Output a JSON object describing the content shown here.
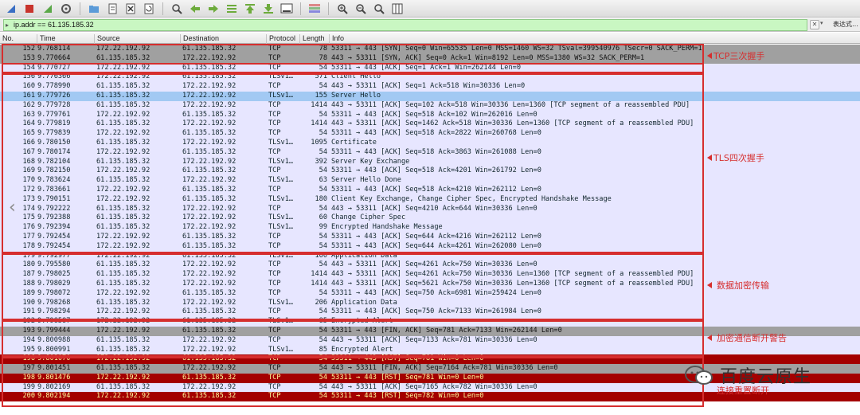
{
  "toolbar": {
    "buttons": [
      "shark-fin-icon",
      "stop-icon",
      "restart-icon",
      "options-icon",
      "open-folder-icon",
      "file-icon",
      "close-file-icon",
      "reload-icon",
      "find-icon",
      "back-icon",
      "forward-icon",
      "goto-icon",
      "first-icon",
      "last-icon",
      "autoscroll-icon",
      "colorize-icon",
      "zoom-in-icon",
      "zoom-out-icon",
      "zoom-normal-icon",
      "resize-columns-icon"
    ]
  },
  "filter": {
    "value": "ip.addr == 61.135.185.32",
    "expression_label": "表达式…"
  },
  "columns": {
    "no": "No.",
    "time": "Time",
    "source": "Source",
    "destination": "Destination",
    "protocol": "Protocol",
    "length": "Length",
    "info": "Info"
  },
  "packets": [
    {
      "no": "152",
      "time": "9.768114",
      "src": "172.22.192.92",
      "dst": "61.135.185.32",
      "proto": "TCP",
      "len": "78",
      "info": "53311 → 443 [SYN] Seq=0 Win=65535 Len=0 MSS=1460 WS=32 TSval=399540976 TSecr=0 SACK_PERM=1",
      "style": "gray"
    },
    {
      "no": "153",
      "time": "9.770664",
      "src": "61.135.185.32",
      "dst": "172.22.192.92",
      "proto": "TCP",
      "len": "78",
      "info": "443 → 53311 [SYN, ACK] Seq=0 Ack=1 Win=8192 Len=0 MSS=1380 WS=32 SACK_PERM=1",
      "style": "gray"
    },
    {
      "no": "154",
      "time": "9.770727",
      "src": "172.22.192.92",
      "dst": "61.135.185.32",
      "proto": "TCP",
      "len": "54",
      "info": "53311 → 443 [ACK] Seq=1 Ack=1 Win=262144 Len=0",
      "style": "tcp"
    },
    {
      "no": "156",
      "time": "9.776366",
      "src": "172.22.192.92",
      "dst": "61.135.185.32",
      "proto": "TLSv1…",
      "len": "571",
      "info": "Client Hello",
      "style": "tls"
    },
    {
      "no": "160",
      "time": "9.778990",
      "src": "61.135.185.32",
      "dst": "172.22.192.92",
      "proto": "TCP",
      "len": "54",
      "info": "443 → 53311 [ACK] Seq=1 Ack=518 Win=30336 Len=0",
      "style": "tcp"
    },
    {
      "no": "161",
      "time": "9.779726",
      "src": "61.135.185.32",
      "dst": "172.22.192.92",
      "proto": "TLSv1…",
      "len": "155",
      "info": "Server Hello",
      "style": "sel"
    },
    {
      "no": "162",
      "time": "9.779728",
      "src": "61.135.185.32",
      "dst": "172.22.192.92",
      "proto": "TCP",
      "len": "1414",
      "info": "443 → 53311 [ACK] Seq=102 Ack=518 Win=30336 Len=1360 [TCP segment of a reassembled PDU]",
      "style": "tcp"
    },
    {
      "no": "163",
      "time": "9.779761",
      "src": "172.22.192.92",
      "dst": "61.135.185.32",
      "proto": "TCP",
      "len": "54",
      "info": "53311 → 443 [ACK] Seq=518 Ack=102 Win=262016 Len=0",
      "style": "tcp"
    },
    {
      "no": "164",
      "time": "9.779819",
      "src": "61.135.185.32",
      "dst": "172.22.192.92",
      "proto": "TCP",
      "len": "1414",
      "info": "443 → 53311 [ACK] Seq=1462 Ack=518 Win=30336 Len=1360 [TCP segment of a reassembled PDU]",
      "style": "tcp"
    },
    {
      "no": "165",
      "time": "9.779839",
      "src": "172.22.192.92",
      "dst": "61.135.185.32",
      "proto": "TCP",
      "len": "54",
      "info": "53311 → 443 [ACK] Seq=518 Ack=2822 Win=260768 Len=0",
      "style": "tcp"
    },
    {
      "no": "166",
      "time": "9.780150",
      "src": "61.135.185.32",
      "dst": "172.22.192.92",
      "proto": "TLSv1…",
      "len": "1095",
      "info": "Certificate",
      "style": "tls"
    },
    {
      "no": "167",
      "time": "9.780174",
      "src": "172.22.192.92",
      "dst": "61.135.185.32",
      "proto": "TCP",
      "len": "54",
      "info": "53311 → 443 [ACK] Seq=518 Ack=3863 Win=261088 Len=0",
      "style": "tcp"
    },
    {
      "no": "168",
      "time": "9.782104",
      "src": "61.135.185.32",
      "dst": "172.22.192.92",
      "proto": "TLSv1…",
      "len": "392",
      "info": "Server Key Exchange",
      "style": "tls"
    },
    {
      "no": "169",
      "time": "9.782150",
      "src": "172.22.192.92",
      "dst": "61.135.185.32",
      "proto": "TCP",
      "len": "54",
      "info": "53311 → 443 [ACK] Seq=518 Ack=4201 Win=261792 Len=0",
      "style": "tcp"
    },
    {
      "no": "170",
      "time": "9.783624",
      "src": "61.135.185.32",
      "dst": "172.22.192.92",
      "proto": "TLSv1…",
      "len": "63",
      "info": "Server Hello Done",
      "style": "tls"
    },
    {
      "no": "172",
      "time": "9.783661",
      "src": "172.22.192.92",
      "dst": "61.135.185.32",
      "proto": "TCP",
      "len": "54",
      "info": "53311 → 443 [ACK] Seq=518 Ack=4210 Win=262112 Len=0",
      "style": "tcp"
    },
    {
      "no": "173",
      "time": "9.790151",
      "src": "172.22.192.92",
      "dst": "61.135.185.32",
      "proto": "TLSv1…",
      "len": "180",
      "info": "Client Key Exchange, Change Cipher Spec, Encrypted Handshake Message",
      "style": "tls"
    },
    {
      "no": "174",
      "time": "9.792222",
      "src": "61.135.185.32",
      "dst": "172.22.192.92",
      "proto": "TCP",
      "len": "54",
      "info": "443 → 53311 [ACK] Seq=4210 Ack=644 Win=30336 Len=0",
      "style": "tcp"
    },
    {
      "no": "175",
      "time": "9.792388",
      "src": "61.135.185.32",
      "dst": "172.22.192.92",
      "proto": "TLSv1…",
      "len": "60",
      "info": "Change Cipher Spec",
      "style": "tls"
    },
    {
      "no": "176",
      "time": "9.792394",
      "src": "61.135.185.32",
      "dst": "172.22.192.92",
      "proto": "TLSv1…",
      "len": "99",
      "info": "Encrypted Handshake Message",
      "style": "tls"
    },
    {
      "no": "177",
      "time": "9.792454",
      "src": "172.22.192.92",
      "dst": "61.135.185.32",
      "proto": "TCP",
      "len": "54",
      "info": "53311 → 443 [ACK] Seq=644 Ack=4216 Win=262112 Len=0",
      "style": "tcp"
    },
    {
      "no": "178",
      "time": "9.792454",
      "src": "172.22.192.92",
      "dst": "61.135.185.32",
      "proto": "TCP",
      "len": "54",
      "info": "53311 → 443 [ACK] Seq=644 Ack=4261 Win=262080 Len=0",
      "style": "tcp"
    },
    {
      "no": "179",
      "time": "9.792977",
      "src": "172.22.192.92",
      "dst": "61.135.185.32",
      "proto": "TLSv1…",
      "len": "160",
      "info": "Application Data",
      "style": "tls"
    },
    {
      "no": "180",
      "time": "9.795580",
      "src": "61.135.185.32",
      "dst": "172.22.192.92",
      "proto": "TCP",
      "len": "54",
      "info": "443 → 53311 [ACK] Seq=4261 Ack=750 Win=30336 Len=0",
      "style": "tcp"
    },
    {
      "no": "187",
      "time": "9.798025",
      "src": "61.135.185.32",
      "dst": "172.22.192.92",
      "proto": "TCP",
      "len": "1414",
      "info": "443 → 53311 [ACK] Seq=4261 Ack=750 Win=30336 Len=1360 [TCP segment of a reassembled PDU]",
      "style": "tcp"
    },
    {
      "no": "188",
      "time": "9.798029",
      "src": "61.135.185.32",
      "dst": "172.22.192.92",
      "proto": "TCP",
      "len": "1414",
      "info": "443 → 53311 [ACK] Seq=5621 Ack=750 Win=30336 Len=1360 [TCP segment of a reassembled PDU]",
      "style": "tcp"
    },
    {
      "no": "189",
      "time": "9.798072",
      "src": "172.22.192.92",
      "dst": "61.135.185.32",
      "proto": "TCP",
      "len": "54",
      "info": "53311 → 443 [ACK] Seq=750 Ack=6981 Win=259424 Len=0",
      "style": "tcp"
    },
    {
      "no": "190",
      "time": "9.798268",
      "src": "61.135.185.32",
      "dst": "172.22.192.92",
      "proto": "TLSv1…",
      "len": "206",
      "info": "Application Data",
      "style": "tls"
    },
    {
      "no": "191",
      "time": "9.798294",
      "src": "172.22.192.92",
      "dst": "61.135.185.32",
      "proto": "TCP",
      "len": "54",
      "info": "53311 → 443 [ACK] Seq=750 Ack=7133 Win=261984 Len=0",
      "style": "tcp"
    },
    {
      "no": "192",
      "time": "9.798587",
      "src": "172.22.192.92",
      "dst": "61.135.185.32",
      "proto": "TLSv1…",
      "len": "85",
      "info": "Encrypted Alert",
      "style": "tls"
    },
    {
      "no": "193",
      "time": "9.799444",
      "src": "172.22.192.92",
      "dst": "61.135.185.32",
      "proto": "TCP",
      "len": "54",
      "info": "53311 → 443 [FIN, ACK] Seq=781 Ack=7133 Win=262144 Len=0",
      "style": "gray"
    },
    {
      "no": "194",
      "time": "9.800988",
      "src": "61.135.185.32",
      "dst": "172.22.192.92",
      "proto": "TCP",
      "len": "54",
      "info": "443 → 53311 [ACK] Seq=7133 Ack=781 Win=30336 Len=0",
      "style": "tcp"
    },
    {
      "no": "195",
      "time": "9.800991",
      "src": "61.135.185.32",
      "dst": "172.22.192.92",
      "proto": "TLSv1…",
      "len": "85",
      "info": "Encrypted Alert",
      "style": "tls"
    },
    {
      "no": "196",
      "time": "9.801070",
      "src": "172.22.192.92",
      "dst": "61.135.185.32",
      "proto": "TCP",
      "len": "54",
      "info": "53311 → 443 [RST] Seq=781 Win=0 Len=0",
      "style": "rst"
    },
    {
      "no": "197",
      "time": "9.801451",
      "src": "61.135.185.32",
      "dst": "172.22.192.92",
      "proto": "TCP",
      "len": "54",
      "info": "443 → 53311 [FIN, ACK] Seq=7164 Ack=781 Win=30336 Len=0",
      "style": "gray"
    },
    {
      "no": "198",
      "time": "9.801476",
      "src": "172.22.192.92",
      "dst": "61.135.185.32",
      "proto": "TCP",
      "len": "54",
      "info": "53311 → 443 [RST] Seq=781 Win=0 Len=0",
      "style": "rst"
    },
    {
      "no": "199",
      "time": "9.802169",
      "src": "61.135.185.32",
      "dst": "172.22.192.92",
      "proto": "TCP",
      "len": "54",
      "info": "443 → 53311 [ACK] Seq=7165 Ack=782 Win=30336 Len=0",
      "style": "tcp"
    },
    {
      "no": "200",
      "time": "9.802194",
      "src": "172.22.192.92",
      "dst": "61.135.185.32",
      "proto": "TCP",
      "len": "54",
      "info": "53311 → 443 [RST] Seq=782 Win=0 Len=0",
      "style": "rst"
    }
  ],
  "annotations": {
    "tcp_handshake": "TCP三次握手",
    "tls_handshake": "TLS四次握手",
    "data_transfer": "数据加密传输",
    "alert": "加密通信断开警告",
    "disconnect": "连接重置断开"
  },
  "watermark": {
    "text": "百度云原生"
  },
  "colors": {
    "annotation": "#d62e2e",
    "rst_bg": "#a40000",
    "rst_fg": "#fffc9c",
    "gray_bg": "#a0a0a0",
    "default_bg": "#e7e6ff",
    "selected_bg": "#a2c9f3",
    "filter_bg": "#c9f7c2"
  }
}
